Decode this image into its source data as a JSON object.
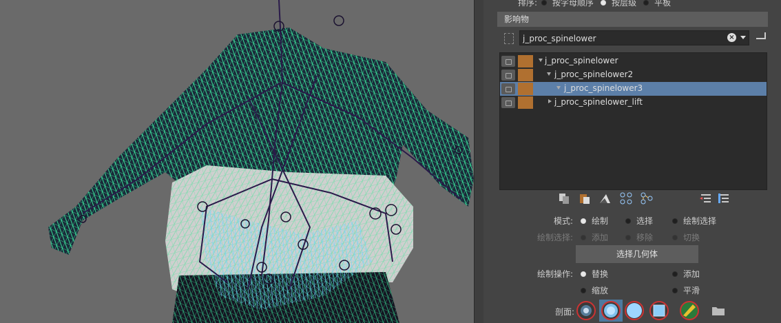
{
  "sort": {
    "label": "排序:",
    "opt1": "按字母顺序",
    "opt2": "按层级",
    "opt3": "平板"
  },
  "influences": {
    "header": "影响物",
    "search_value": "j_proc_spinelower",
    "tree": [
      {
        "label": "j_proc_spinelower",
        "expanded": true,
        "selected": false
      },
      {
        "label": "j_proc_spinelower2",
        "expanded": true,
        "selected": false
      },
      {
        "label": "j_proc_spinelower3",
        "expanded": true,
        "selected": true
      },
      {
        "label": "j_proc_spinelower_lift",
        "expanded": false,
        "selected": false
      }
    ]
  },
  "toolbar_icons": [
    "copy-weights-icon",
    "paste-weights-icon",
    "prune-icon",
    "joint-hierarchy-icon",
    "joint-select-icon",
    "list-left-icon",
    "list-right-icon"
  ],
  "mode": {
    "label": "模式:",
    "paint": "绘制",
    "select": "选择",
    "paint_select": "绘制选择"
  },
  "paint_select": {
    "label": "绘制选择:",
    "add": "添加",
    "remove": "移除",
    "toggle": "切换"
  },
  "select_geometry_button": "选择几何体",
  "paint_op": {
    "label": "绘制操作:",
    "replace": "替换",
    "add": "添加",
    "scale": "缩放",
    "smooth": "平滑"
  },
  "profile": {
    "label": "剖面:"
  },
  "colors": {
    "accent_selected": "#5c7fa8",
    "swatch": "#b07030",
    "wire_green": "#3dffa8",
    "wire_cyan": "#6fd8ff"
  }
}
